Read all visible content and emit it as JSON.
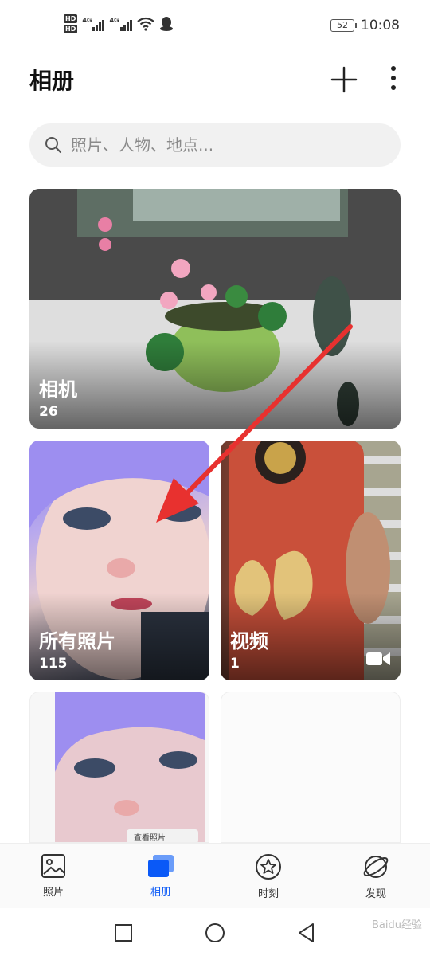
{
  "status_bar": {
    "hd_top": "HD",
    "hd_bottom": "HD",
    "net1": "4G",
    "net2": "4G",
    "battery": "52",
    "time": "10:08"
  },
  "header": {
    "title": "相册"
  },
  "search": {
    "placeholder": "照片、人物、地点..."
  },
  "albums": [
    {
      "name": "相机",
      "count": "26"
    },
    {
      "name": "所有照片",
      "count": "115"
    },
    {
      "name": "视频",
      "count": "1"
    }
  ],
  "screenshot_overlay": "查看照片",
  "bottom_nav": [
    {
      "label": "照片"
    },
    {
      "label": "相册"
    },
    {
      "label": "时刻"
    },
    {
      "label": "发现"
    }
  ],
  "colors": {
    "accent": "#0a59f7",
    "arrow": "#e8312f"
  },
  "watermark": "Baidu经验"
}
